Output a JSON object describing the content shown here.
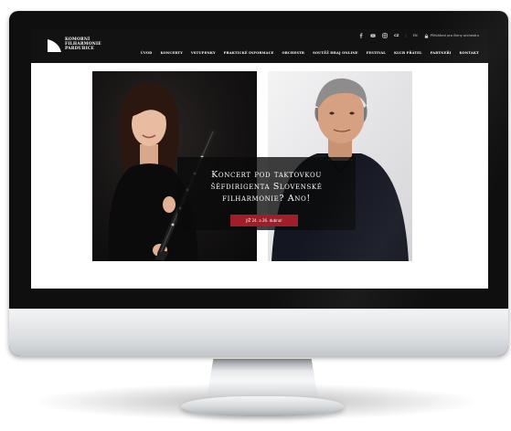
{
  "site": {
    "logo_lines": [
      "KOMORNÍ",
      "FILHARMONIE",
      "PARDUBICE"
    ],
    "topbar": {
      "icons": [
        "facebook-icon",
        "youtube-icon",
        "instagram-icon"
      ],
      "lang_active": "CZ",
      "lang_separator": "|",
      "lang_other": "EN",
      "login": "Přihlášení pro členy orchestru"
    },
    "nav": [
      "ÚVOD",
      "KONCERTY",
      "VSTUPENKY",
      "PRAKTICKÉ INFORMACE",
      "ORCHESTR",
      "SOUTĚŽ HRAJ ONLINE",
      "FESTIVAL",
      "KLUB PŘÁTEL",
      "PARTNEŘI",
      "KONTAKT"
    ]
  },
  "hero": {
    "title_line1": "Koncert pod taktovkou",
    "title_line2": "šéfdirigenta Slovenské",
    "title_line3": "filharmonie? Ano!",
    "cta": "JIŽ 24. a 26. dubna!"
  },
  "colors": {
    "header_bg": "#121212",
    "cta_bg": "#a01d2a",
    "bezel": "#0f0f10"
  }
}
